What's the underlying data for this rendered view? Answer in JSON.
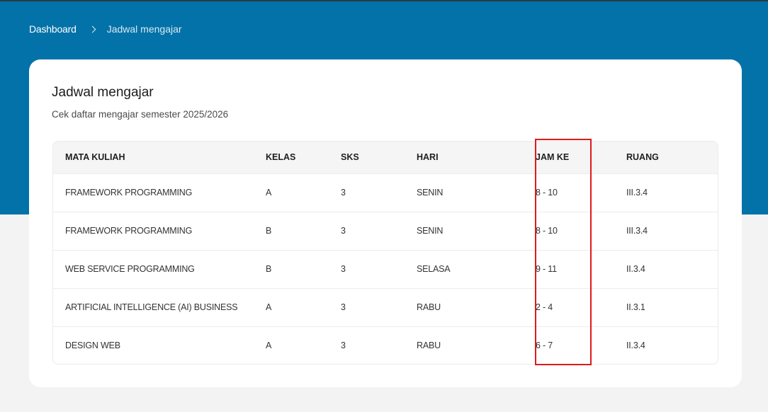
{
  "breadcrumb": {
    "home": "Dashboard",
    "current": "Jadwal mengajar"
  },
  "card": {
    "title": "Jadwal mengajar",
    "subtitle": "Cek daftar mengajar semester 2025/2026"
  },
  "table": {
    "headers": [
      "MATA KULIAH",
      "KELAS",
      "SKS",
      "HARI",
      "JAM KE",
      "RUANG"
    ],
    "rows": [
      [
        "FRAMEWORK PROGRAMMING",
        "A",
        "3",
        "SENIN",
        "8 - 10",
        "III.3.4"
      ],
      [
        "FRAMEWORK PROGRAMMING",
        "B",
        "3",
        "SENIN",
        "8 - 10",
        "III.3.4"
      ],
      [
        "WEB SERVICE PROGRAMMING",
        "B",
        "3",
        "SELASA",
        "9 - 11",
        "II.3.4"
      ],
      [
        "ARTIFICIAL INTELLIGENCE (AI) BUSINESS",
        "A",
        "3",
        "RABU",
        "2 - 4",
        "II.3.1"
      ],
      [
        "DESIGN WEB",
        "A",
        "3",
        "RABU",
        "6 - 7",
        "II.3.4"
      ]
    ]
  },
  "colors": {
    "header_band": "#0272a8",
    "highlight": "#e0191b"
  }
}
